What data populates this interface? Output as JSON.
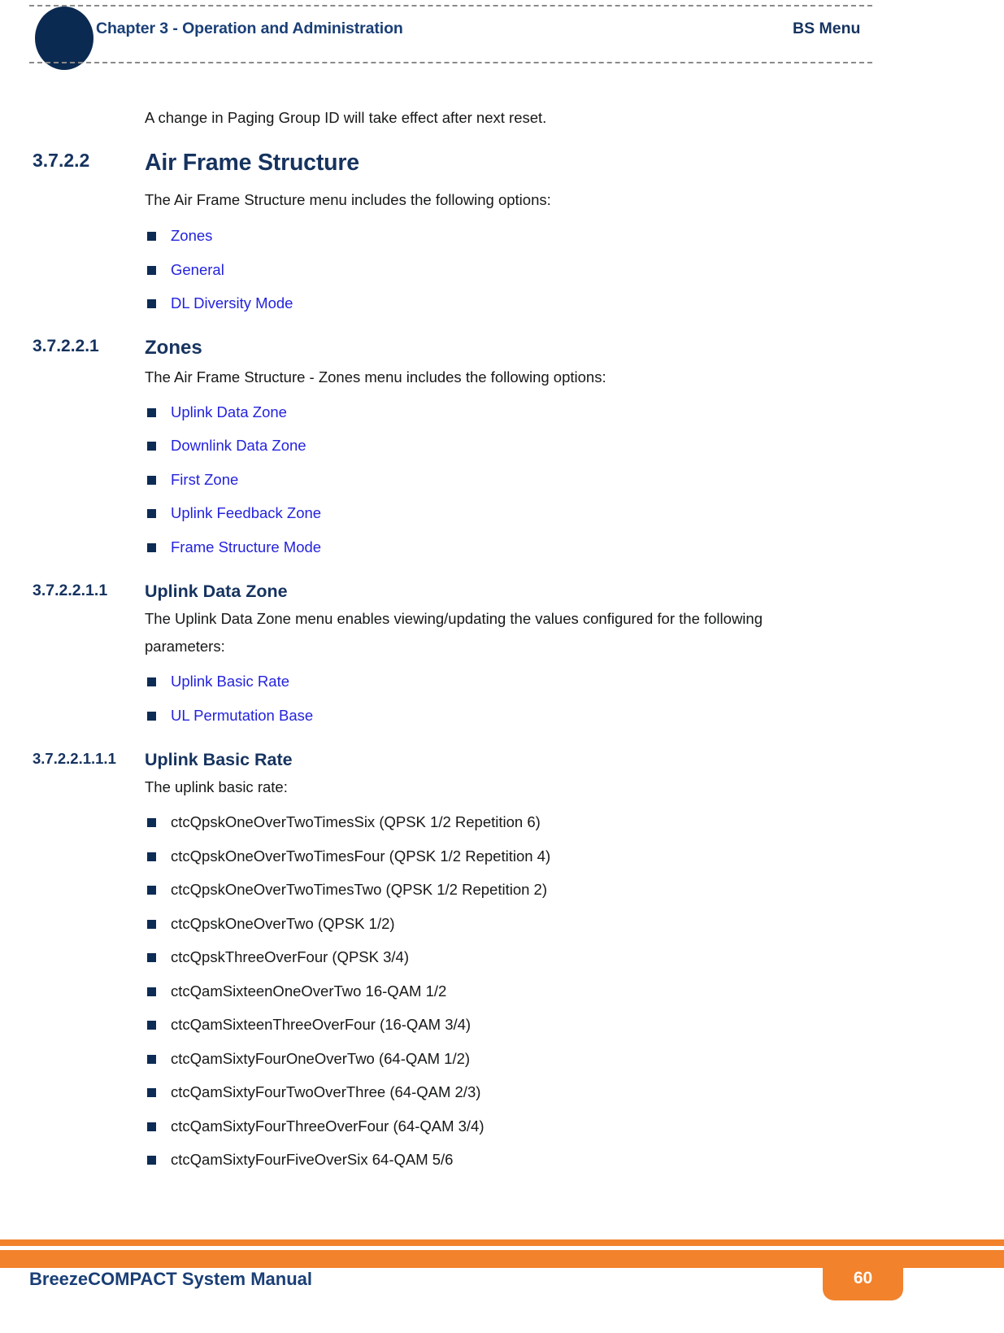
{
  "header": {
    "chapter": "Chapter 3 - Operation and Administration",
    "section": "BS Menu"
  },
  "body": {
    "intro_note": "A change in Paging Group ID will take effect after next reset.",
    "sections": [
      {
        "number": "3.7.2.2",
        "title": "Air Frame Structure",
        "paragraph": "The Air Frame Structure menu includes the following options:",
        "bullets": [
          {
            "label": "Zones",
            "kind": "link"
          },
          {
            "label": "General",
            "kind": "link"
          },
          {
            "label": "DL Diversity Mode",
            "kind": "link"
          }
        ]
      },
      {
        "number": "3.7.2.2.1",
        "title": "Zones",
        "paragraph": "The Air Frame Structure - Zones menu includes the following options:",
        "bullets": [
          {
            "label": "Uplink Data Zone",
            "kind": "link"
          },
          {
            "label": "Downlink Data Zone",
            "kind": "link"
          },
          {
            "label": "First Zone",
            "kind": "link"
          },
          {
            "label": "Uplink Feedback Zone",
            "kind": "link"
          },
          {
            "label": "Frame Structure Mode",
            "kind": "link"
          }
        ]
      },
      {
        "number": "3.7.2.2.1.1",
        "title": "Uplink Data Zone",
        "paragraph_line1": "The Uplink Data Zone menu enables viewing/updating the values configured for the following",
        "paragraph_line2": "parameters:",
        "bullets": [
          {
            "label": "Uplink Basic Rate",
            "kind": "link"
          },
          {
            "label": "UL Permutation Base",
            "kind": "link"
          }
        ]
      },
      {
        "number": "3.7.2.2.1.1.1",
        "title": "Uplink Basic Rate",
        "paragraph": "The uplink basic rate:",
        "bullets": [
          {
            "label": "ctcQpskOneOverTwoTimesSix (QPSK 1/2 Repetition 6)",
            "kind": "plain"
          },
          {
            "label": "ctcQpskOneOverTwoTimesFour (QPSK 1/2 Repetition 4)",
            "kind": "plain"
          },
          {
            "label": "ctcQpskOneOverTwoTimesTwo (QPSK 1/2 Repetition 2)",
            "kind": "plain"
          },
          {
            "label": "ctcQpskOneOverTwo (QPSK 1/2)",
            "kind": "plain"
          },
          {
            "label": "ctcQpskThreeOverFour (QPSK 3/4)",
            "kind": "plain"
          },
          {
            "label": "ctcQamSixteenOneOverTwo 16-QAM 1/2",
            "kind": "plain"
          },
          {
            "label": "ctcQamSixteenThreeOverFour (16-QAM 3/4)",
            "kind": "plain"
          },
          {
            "label": "ctcQamSixtyFourOneOverTwo (64-QAM 1/2)",
            "kind": "plain"
          },
          {
            "label": "ctcQamSixtyFourTwoOverThree (64-QAM 2/3)",
            "kind": "plain"
          },
          {
            "label": "ctcQamSixtyFourThreeOverFour (64-QAM 3/4)",
            "kind": "plain"
          },
          {
            "label": "ctcQamSixtyFourFiveOverSix 64-QAM 5/6",
            "kind": "plain"
          }
        ]
      }
    ]
  },
  "footer": {
    "manual_title": "BreezeCOMPACT System Manual",
    "page_number": "60"
  },
  "colors": {
    "navy": "#16335f",
    "circle_navy": "#0b2a52",
    "link_blue": "#2423dd",
    "orange": "#f2822c",
    "header_blue": "#1a3f76"
  }
}
